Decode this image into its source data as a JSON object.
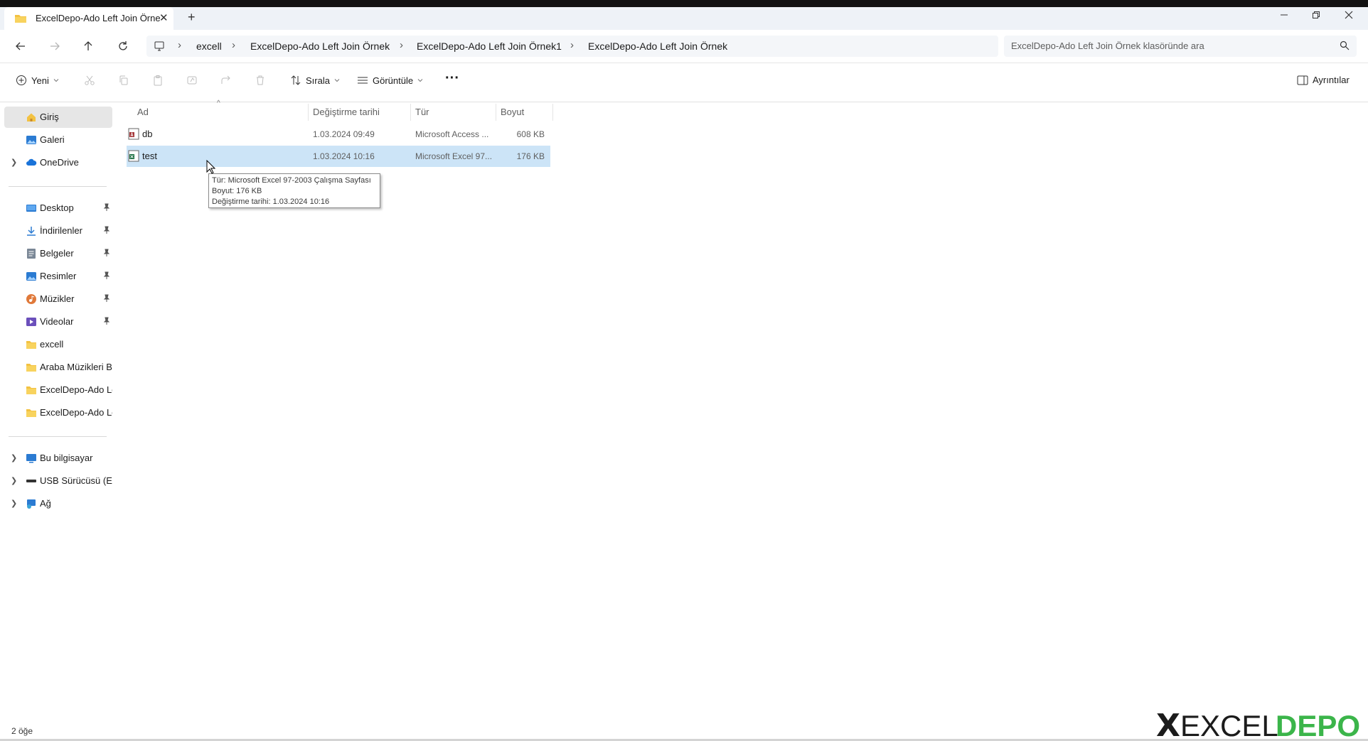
{
  "window": {
    "tab_title": "ExcelDepo-Ado Left Join Örne",
    "tab_close": "✕",
    "new_tab": "+"
  },
  "address": {
    "crumbs": [
      "excell",
      "ExcelDepo-Ado Left Join Örnek",
      "ExcelDepo-Ado Left Join Örnek1",
      "ExcelDepo-Ado Left Join Örnek"
    ],
    "separator": "›"
  },
  "search": {
    "placeholder": "ExcelDepo-Ado Left Join Örnek klasöründe ara"
  },
  "toolbar": {
    "new_label": "Yeni",
    "sort_label": "Sırala",
    "view_label": "Görüntüle",
    "more_label": "···",
    "details_label": "Ayrıntılar"
  },
  "sidebar": {
    "items": [
      {
        "label": "Giriş"
      },
      {
        "label": "Galeri"
      },
      {
        "label": "OneDrive"
      },
      {
        "label": "Desktop"
      },
      {
        "label": "İndirilenler"
      },
      {
        "label": "Belgeler"
      },
      {
        "label": "Resimler"
      },
      {
        "label": "Müzikler"
      },
      {
        "label": "Videolar"
      },
      {
        "label": "excell"
      },
      {
        "label": "Araba Müzikleri Bas"
      },
      {
        "label": "ExcelDepo-Ado Lef"
      },
      {
        "label": "ExcelDepo-Ado Lef"
      },
      {
        "label": "Bu bilgisayar"
      },
      {
        "label": "USB Sürücüsü (E:)"
      },
      {
        "label": "Ağ"
      }
    ]
  },
  "columns": {
    "name": "Ad",
    "modified": "Değiştirme tarihi",
    "type": "Tür",
    "size": "Boyut"
  },
  "files": [
    {
      "name": "db",
      "modified": "1.03.2024 09:49",
      "type": "Microsoft Access ...",
      "size": "608 KB"
    },
    {
      "name": "test",
      "modified": "1.03.2024 10:16",
      "type": "Microsoft Excel 97...",
      "size": "176 KB"
    }
  ],
  "tooltip": {
    "line1": "Tür: Microsoft Excel 97-2003 Çalışma Sayfası",
    "line2": "Boyut: 176 KB",
    "line3": "Değiştirme tarihi: 1.03.2024 10:16"
  },
  "status": {
    "count": "2 öğe"
  },
  "colors": {
    "selection": "#cce4f7",
    "accent": "#0067c0",
    "logo_green": "#3bb54a"
  }
}
